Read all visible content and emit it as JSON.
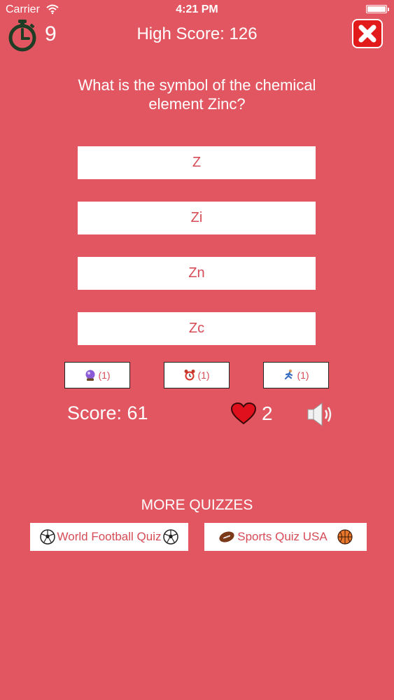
{
  "status_bar": {
    "carrier": "Carrier",
    "time": "4:21 PM"
  },
  "header": {
    "timer_value": "9",
    "high_score": "High Score: 126"
  },
  "question": "What is the symbol of the chemical element Zinc?",
  "answers": [
    "Z",
    "Zi",
    "Zn",
    "Zc"
  ],
  "lifelines": [
    {
      "icon": "crystal-ball-icon",
      "count": "(1)"
    },
    {
      "icon": "alarm-clock-icon",
      "count": "(1)"
    },
    {
      "icon": "runner-icon",
      "count": "(1)"
    }
  ],
  "score": "Score: 61",
  "lives": "2",
  "more_quizzes": {
    "title": "MORE QUIZZES",
    "links": [
      {
        "label": "World Football Quiz",
        "icons": [
          "soccer-ball-icon",
          "soccer-ball-icon"
        ]
      },
      {
        "label": "Sports Quiz USA",
        "icons": [
          "american-football-icon",
          "basketball-icon"
        ]
      }
    ]
  },
  "colors": {
    "background": "#e15660",
    "answer_text": "#d64b56",
    "close_button": "#e31a1c",
    "timer_icon": "#1e3d24",
    "heart": "#e0101c"
  }
}
